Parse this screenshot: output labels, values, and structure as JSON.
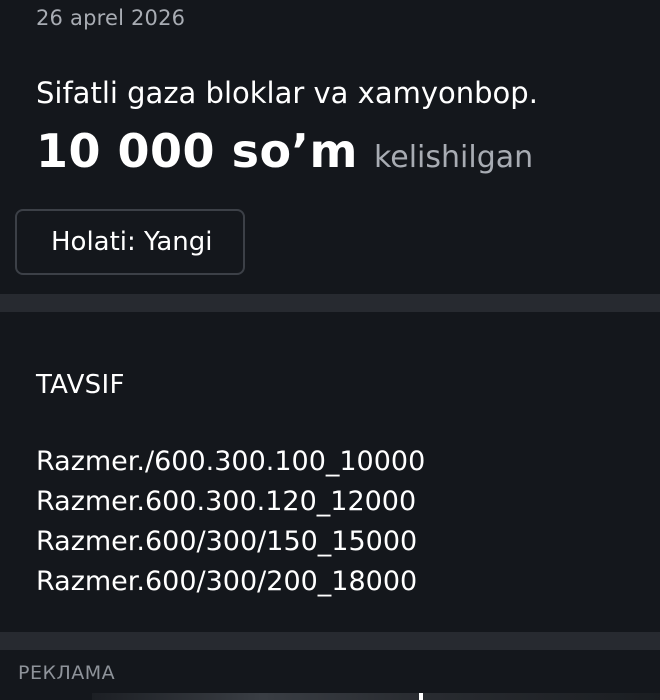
{
  "listing": {
    "date": "26 aprel 2026",
    "title": "Sifatli gaza bloklar va xamyonbop.",
    "price": "10 000 so’m",
    "price_note": "kelishilgan",
    "condition": "Holati: Yangi"
  },
  "description": {
    "heading": "TAVSIF",
    "lines": [
      "Razmer./600.300.100_10000",
      "Razmer.600.300.120_12000",
      "Razmer.600/300/150_15000",
      "Razmer.600/300/200_18000"
    ]
  },
  "ad": {
    "label": "РЕКЛАМА"
  },
  "colors": {
    "background": "#14171c",
    "divider": "#272a30",
    "muted_text": "#a8acb3",
    "chip_border": "#3c4047"
  }
}
